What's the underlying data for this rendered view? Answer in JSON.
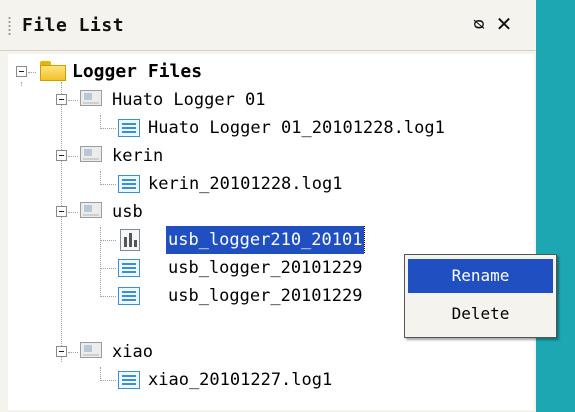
{
  "panel": {
    "title": "File List",
    "pin_glyph": "I̲",
    "close_glyph": "✕",
    "pin_icon": "pin-icon",
    "close_icon": "close-icon"
  },
  "tree": {
    "root": {
      "label": "Logger Files",
      "icon": "folder-icon",
      "expanded": true
    },
    "loggers": [
      {
        "label": "Huato Logger 01",
        "icon": "device-icon",
        "expanded": true,
        "files": [
          {
            "label": "Huato Logger 01_20101228.log1",
            "icon": "log-file-icon"
          }
        ]
      },
      {
        "label": "kerin",
        "icon": "device-icon",
        "expanded": true,
        "files": [
          {
            "label": "kerin_20101228.log1",
            "icon": "log-file-icon"
          }
        ]
      },
      {
        "label": "usb",
        "icon": "device-icon",
        "expanded": true,
        "files": [
          {
            "label": "usb_logger210_20101",
            "icon": "sheet-file-icon",
            "selected": true
          },
          {
            "label": "usb_logger_20101229",
            "icon": "log-file-icon"
          },
          {
            "label": "usb_logger_20101229",
            "icon": "log-file-icon"
          }
        ]
      },
      {
        "label": "xiao",
        "icon": "device-icon",
        "expanded": true,
        "files": [
          {
            "label": "xiao_20101227.log1",
            "icon": "log-file-icon"
          }
        ]
      }
    ]
  },
  "context_menu": {
    "items": [
      {
        "label": "Rename",
        "highlighted": true
      },
      {
        "label": "Delete",
        "highlighted": false
      }
    ]
  },
  "colors": {
    "selection": "#1f4fc1",
    "panel_bg": "#f4f3ee",
    "side_strip": "#1ca7b3"
  }
}
